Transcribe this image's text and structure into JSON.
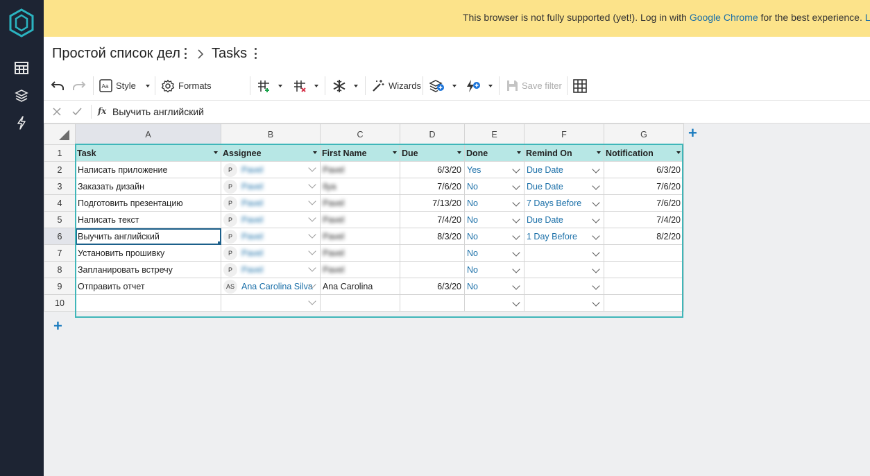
{
  "banner": {
    "text_before": "This browser is not fully supported (yet!). Log in with ",
    "link_chrome": "Google Chrome",
    "text_after": " for the best experience. ",
    "link_more": "Le"
  },
  "breadcrumb": {
    "document": "Простой список дел",
    "table": "Tasks"
  },
  "toolbar": {
    "style": "Style",
    "formats": "Formats",
    "wizards": "Wizards",
    "save_filter": "Save filter"
  },
  "formula_bar": {
    "fx": "fx",
    "value": "Выучить английский"
  },
  "columns": [
    "A",
    "B",
    "C",
    "D",
    "E",
    "F",
    "G"
  ],
  "header_row": {
    "num": "1",
    "cells": [
      "Task",
      "Assignee",
      "First Name",
      "Due",
      "Done",
      "Remind On",
      "Notification"
    ]
  },
  "rows": [
    {
      "num": "2",
      "task": "Написать приложение",
      "avatar": "P",
      "assignee": "Pavel",
      "first": "Pavel",
      "due": "6/3/20",
      "done": "Yes",
      "remind": "Due Date",
      "notification": "6/3/20"
    },
    {
      "num": "3",
      "task": "Заказать дизайн",
      "avatar": "P",
      "assignee": "Pavel",
      "first": "Ilya",
      "due": "7/6/20",
      "done": "No",
      "remind": "Due Date",
      "notification": "7/6/20"
    },
    {
      "num": "4",
      "task": "Подготовить презентацию",
      "avatar": "P",
      "assignee": "Pavel",
      "first": "Pavel",
      "due": "7/13/20",
      "done": "No",
      "remind": "7 Days Before",
      "notification": "7/6/20"
    },
    {
      "num": "5",
      "task": "Написать текст",
      "avatar": "P",
      "assignee": "Pavel",
      "first": "Pavel",
      "due": "7/4/20",
      "done": "No",
      "remind": "Due Date",
      "notification": "7/4/20"
    },
    {
      "num": "6",
      "task": "Выучить английский",
      "avatar": "P",
      "assignee": "Pavel",
      "first": "Pavel",
      "due": "8/3/20",
      "done": "No",
      "remind": "1 Day Before",
      "notification": "8/2/20"
    },
    {
      "num": "7",
      "task": "Установить прошивку",
      "avatar": "P",
      "assignee": "Pavel",
      "first": "Pavel",
      "due": "",
      "done": "No",
      "remind": "",
      "notification": ""
    },
    {
      "num": "8",
      "task": "Запланировать встречу",
      "avatar": "P",
      "assignee": "Pavel",
      "first": "Pavel",
      "due": "",
      "done": "No",
      "remind": "",
      "notification": ""
    },
    {
      "num": "9",
      "task": "Отправить отчет",
      "avatar": "AS",
      "assignee": "Ana Carolina Silva",
      "first": "Ana Carolina",
      "due": "6/3/20",
      "done": "No",
      "remind": "",
      "notification": ""
    },
    {
      "num": "10",
      "task": "",
      "avatar": "",
      "assignee": "",
      "first": "",
      "due": "",
      "done": "",
      "remind": "",
      "notification": ""
    }
  ],
  "add_symbol": "+",
  "colors": {
    "sidebar": "#1d2433",
    "banner": "#fce38a",
    "header_fill": "#b7e7e5",
    "table_border": "#3fb6b9",
    "link": "#1a6fa8",
    "add": "#1a7bbf"
  },
  "icons": {
    "sidebar": [
      "grist-logo-icon",
      "table-icon",
      "layers-icon",
      "lightning-icon"
    ],
    "toolbar": [
      "undo-icon",
      "redo-icon",
      "style-icon",
      "gear-icon",
      "insert-column-icon",
      "delete-column-icon",
      "freeze-icon",
      "wand-icon",
      "add-widget-icon",
      "add-action-icon",
      "save-icon",
      "grid-icon"
    ]
  }
}
